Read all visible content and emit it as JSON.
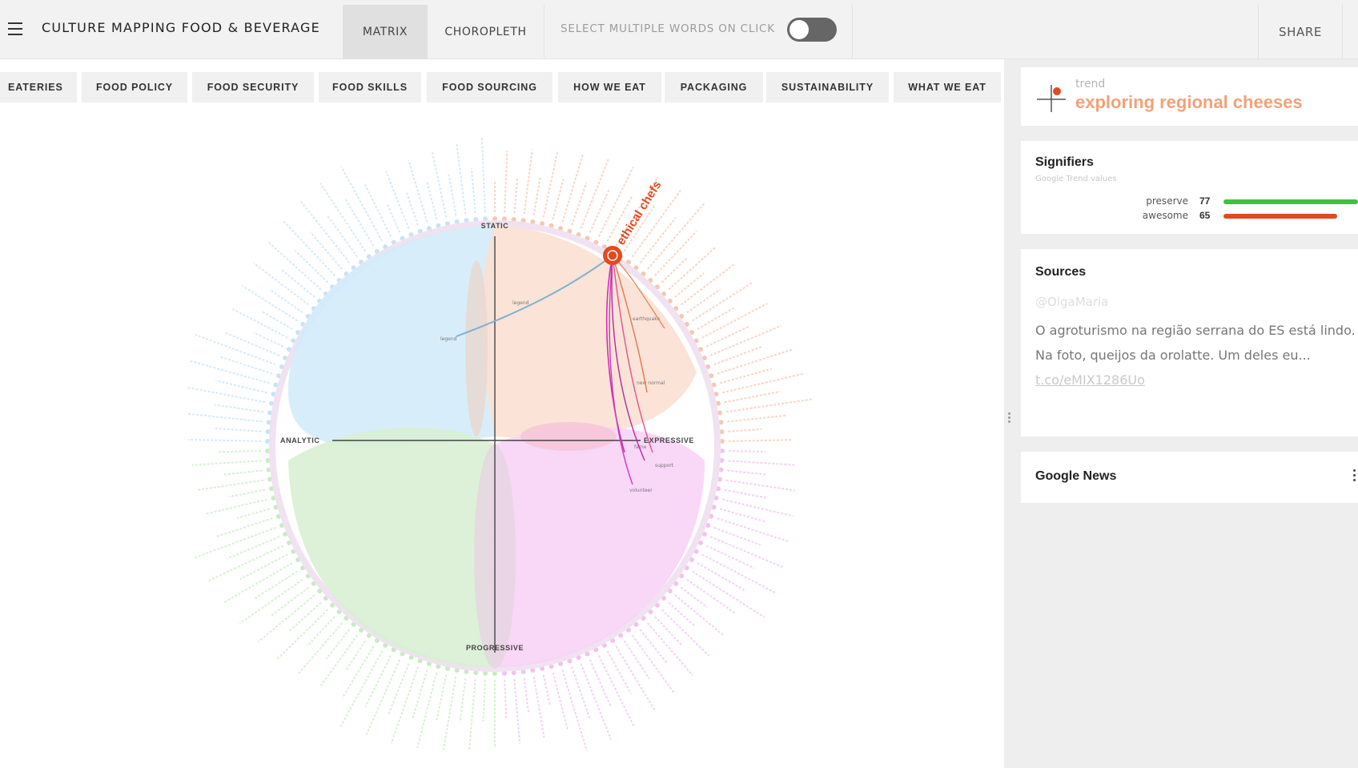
{
  "header": {
    "app_title": "CULTURE MAPPING FOOD & BEVERAGE",
    "tabs": [
      {
        "label": "MATRIX",
        "active": true
      },
      {
        "label": "CHOROPLETH",
        "active": false
      }
    ],
    "multi_select_label": "SELECT MULTIPLE WORDS ON CLICK",
    "multi_select_on": false,
    "share_label": "SHARE"
  },
  "categories": [
    "EATERIES",
    "FOOD POLICY",
    "FOOD SECURITY",
    "FOOD SKILLS",
    "FOOD SOURCING",
    "HOW WE EAT",
    "PACKAGING",
    "SUSTAINABILITY",
    "WHAT WE EAT"
  ],
  "matrix": {
    "axes": {
      "top": "STATIC",
      "left": "ANALYTIC",
      "right": "EXPRESSIVE",
      "bottom": "PROGRESSIVE"
    },
    "selected_word": "ethical chefs",
    "small_labels": [
      "legend",
      "legend",
      "earthquake",
      "new normal",
      "fame",
      "support",
      "volunteer"
    ],
    "quadrant_colors": {
      "static_analytic": "#d3ecfa",
      "static_expressive": "#fbe0d4",
      "progressive_analytic": "#d8f0d4",
      "progressive_expressive": "#f8d3f6"
    },
    "accent_color": "#e5481f"
  },
  "panel": {
    "trend": {
      "label": "trend",
      "value": "exploring regional cheeses"
    },
    "signifiers": {
      "title": "Signifiers",
      "subtitle": "Google Trend values",
      "items": [
        {
          "word": "preserve",
          "value": 77,
          "color": "#3cc43c"
        },
        {
          "word": "awesome",
          "value": 65,
          "color": "#e5481f"
        }
      ]
    },
    "sources": {
      "title": "Sources",
      "handle": "@OlgaMaria",
      "text": "O agroturismo na região serrana do ES está lindo. Na foto, queijos da orolatte. Um deles eu...",
      "link": "t.co/eMIX1286Uo"
    },
    "news": {
      "title": "Google News"
    }
  }
}
